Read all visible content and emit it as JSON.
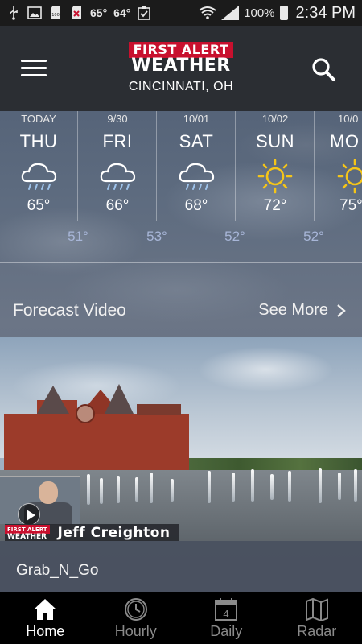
{
  "status_bar": {
    "temp1": "65°",
    "temp2": "64°",
    "battery_percent": "100%",
    "time": "2:34 PM",
    "icons": [
      "usb-icon",
      "image-icon",
      "sd-card-icon",
      "no-sim-icon",
      "clipboard-check-icon",
      "wifi-icon",
      "signal-icon",
      "battery-icon"
    ]
  },
  "header": {
    "logo_top": "FIRST ALERT",
    "logo_bottom": "WEATHER",
    "city": "CINCINNATI, OH",
    "icons": [
      "menu-icon",
      "search-icon"
    ]
  },
  "forecast": {
    "days": [
      {
        "date": "TODAY",
        "name": "THU",
        "icon": "rain-cloud-icon",
        "high": "65°",
        "low": "51°"
      },
      {
        "date": "9/30",
        "name": "FRI",
        "icon": "rain-cloud-icon",
        "high": "66°",
        "low": "53°"
      },
      {
        "date": "10/01",
        "name": "SAT",
        "icon": "rain-cloud-icon",
        "high": "68°",
        "low": "52°"
      },
      {
        "date": "10/02",
        "name": "SUN",
        "icon": "sun-icon",
        "high": "72°",
        "low": "52°"
      },
      {
        "date": "10/0",
        "name": "MO",
        "icon": "sun-icon",
        "high": "75°"
      }
    ]
  },
  "forecast_video": {
    "title": "Forecast Video",
    "see_more": "See More",
    "lower_third_logo_top": "FIRST ALERT",
    "lower_third_logo_bottom": "WEATHER",
    "reporter": "Jeff Creighton",
    "video_title": "Grab_N_Go"
  },
  "colors": {
    "logo_red": "#c8102e",
    "header_bg": "#2b2e33",
    "low_temp": "#a8b6d8",
    "sun_yellow": "#f5c518"
  },
  "bottom_nav": {
    "items": [
      {
        "label": "Home",
        "icon": "home-icon",
        "active": true
      },
      {
        "label": "Hourly",
        "icon": "clock-icon",
        "active": false
      },
      {
        "label": "Daily",
        "icon": "calendar-icon",
        "badge": "4",
        "active": false
      },
      {
        "label": "Radar",
        "icon": "map-icon",
        "active": false
      }
    ]
  }
}
